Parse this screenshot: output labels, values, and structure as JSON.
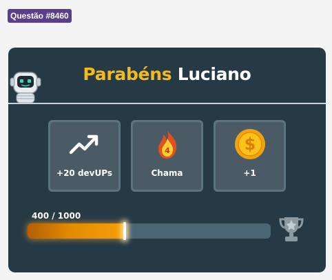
{
  "question_badge": "Questão #8460",
  "header": {
    "greeting": "Parabéns",
    "name": "Luciano"
  },
  "rewards": [
    {
      "icon": "trending-up-icon",
      "label": "+20 devUPs"
    },
    {
      "icon": "flame-icon",
      "label": "Chama",
      "count": "4"
    },
    {
      "icon": "dollar-coin-icon",
      "label": "+1"
    }
  ],
  "progress": {
    "text": "400 / 1000",
    "value": 400,
    "max": 1000
  },
  "colors": {
    "card_bg": "#263a46",
    "accent": "#f6b91b",
    "tile_bg": "#4b5b66",
    "badge_bg": "#5b3f8c"
  }
}
